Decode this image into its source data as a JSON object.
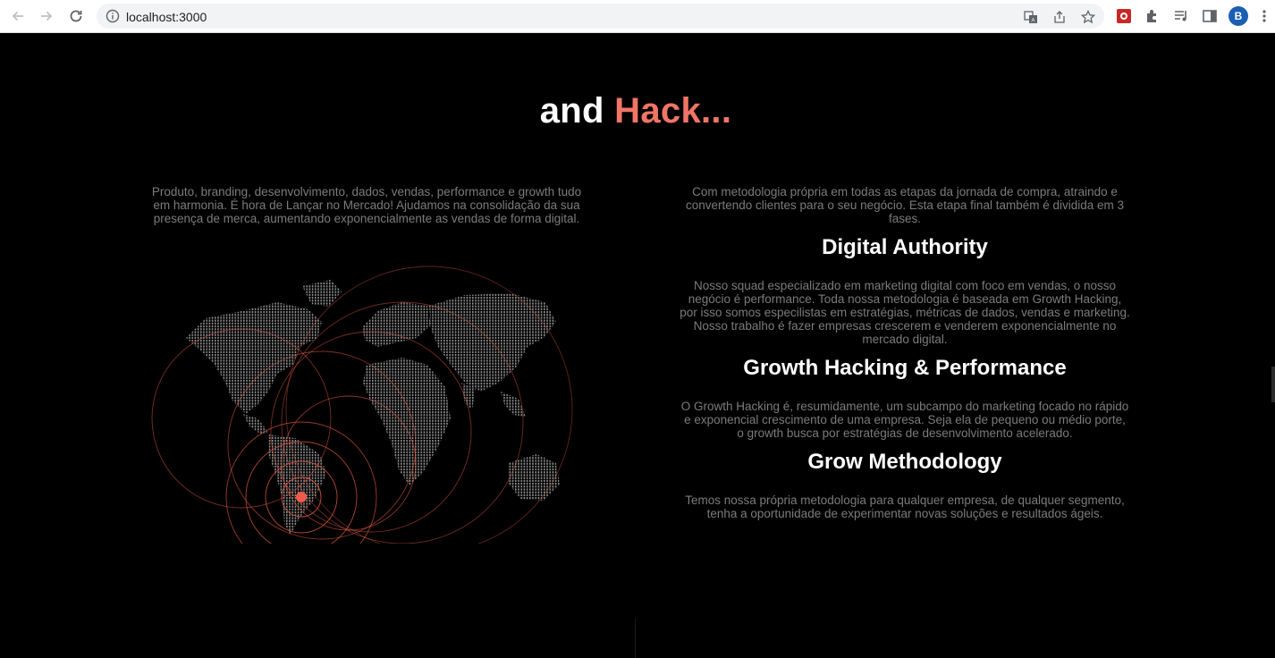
{
  "browser": {
    "url": "localhost:3000",
    "profile_initial": "B",
    "icons": [
      "back-icon",
      "forward-icon",
      "reload-icon",
      "site-info-icon",
      "translate-icon",
      "share-icon",
      "bookmark-star-icon",
      "extension-icon",
      "puzzle-icon",
      "media-icon",
      "side-panel-icon",
      "menu-icon"
    ]
  },
  "hero": {
    "title_white": "and ",
    "title_accent": "Hack..."
  },
  "left": {
    "intro": "Produto, branding, desenvolvimento, dados, vendas, performance e growth tudo em harmonia. É hora de Lançar no Mercado! Ajudamos na consolidação da sua presença de merca, aumentando exponencialmente as vendas de forma digital."
  },
  "right": {
    "intro": "Com metodologia própria em todas as etapas da jornada de compra, atraindo e convertendo clientes para o seu negócio. Esta etapa final também é dividida em 3 fases.",
    "sections": [
      {
        "heading": "Digital Authority",
        "body": "Nosso squad especializado em marketing digital com foco em vendas, o nosso negócio é performance. Toda nossa metodologia é baseada em Growth Hacking, por isso somos especilistas em estratégias, métricas de dados, vendas e marketing. Nosso trabalho é fazer empresas crescerem e venderem exponencialmente no mercado digital."
      },
      {
        "heading": "Growth Hacking & Performance",
        "body": "O Growth Hacking é, resumidamente, um subcampo do marketing focado no rápido e exponencial crescimento de uma empresa. Seja ela de pequeno ou médio porte, o growth busca por estratégias de desenvolvimento acelerado."
      },
      {
        "heading": "Grow Methodology",
        "body": "Temos nossa própria metodologia para qualquer empresa, de qualquer segmento, tenha a oportunidade de experimentar novas soluções e resultados ágeis."
      }
    ]
  },
  "colors": {
    "accent": "#f07565",
    "background": "#000000",
    "body_text": "#7b7b7b",
    "heading": "#ffffff",
    "map_dots": "#9a9a9a",
    "rings": "#e0584a"
  }
}
